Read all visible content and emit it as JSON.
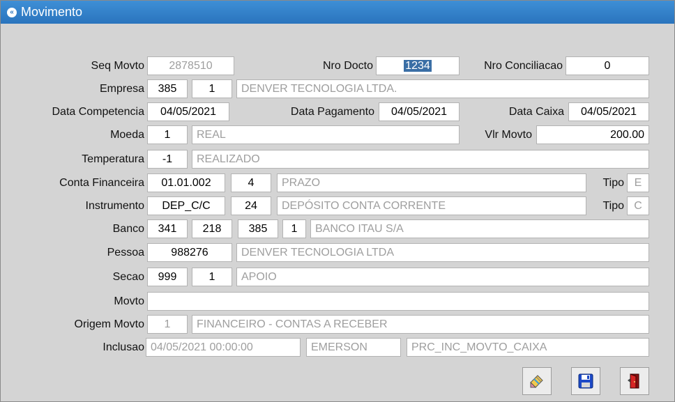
{
  "window": {
    "title": "Movimento"
  },
  "fields": {
    "seq_movto": {
      "label": "Seq Movto",
      "value": "2878510"
    },
    "nro_docto": {
      "label": "Nro Docto",
      "value": "1234"
    },
    "nro_conciliacao": {
      "label": "Nro Conciliacao",
      "value": "0"
    },
    "empresa": {
      "label": "Empresa",
      "code": "385",
      "sub": "1",
      "desc": "DENVER TECNOLOGIA LTDA."
    },
    "data_competencia": {
      "label": "Data Competencia",
      "value": "04/05/2021"
    },
    "data_pagamento": {
      "label": "Data Pagamento",
      "value": "04/05/2021"
    },
    "data_caixa": {
      "label": "Data Caixa",
      "value": "04/05/2021"
    },
    "moeda": {
      "label": "Moeda",
      "code": "1",
      "desc": "REAL"
    },
    "vlr_movto": {
      "label": "Vlr Movto",
      "value": "200.00"
    },
    "temperatura": {
      "label": "Temperatura",
      "code": "-1",
      "desc": "REALIZADO"
    },
    "conta_financeira": {
      "label": "Conta Financeira",
      "code": "01.01.002",
      "sub": "4",
      "desc": "PRAZO",
      "tipo_label": "Tipo",
      "tipo": "E"
    },
    "instrumento": {
      "label": "Instrumento",
      "code": "DEP_C/C",
      "sub": "24",
      "desc": "DEPÓSITO CONTA CORRENTE",
      "tipo_label": "Tipo",
      "tipo": "C"
    },
    "banco": {
      "label": "Banco",
      "code": "341",
      "agencia": "218",
      "conta": "385",
      "sub": "1",
      "desc": "BANCO ITAU S/A"
    },
    "pessoa": {
      "label": "Pessoa",
      "code": "988276",
      "desc": "DENVER TECNOLOGIA LTDA"
    },
    "secao": {
      "label": "Secao",
      "code": "999",
      "sub": "1",
      "desc": "APOIO"
    },
    "movto": {
      "label": "Movto",
      "value": ""
    },
    "origem_movto": {
      "label": "Origem Movto",
      "code": "1",
      "desc": "FINANCEIRO - CONTAS A RECEBER"
    },
    "inclusao": {
      "label": "Inclusao",
      "datetime": "04/05/2021 00:00:00",
      "user": "EMERSON",
      "proc": "PRC_INC_MOVTO_CAIXA"
    }
  },
  "toolbar": {
    "edit_icon": "pencil-eraser-icon",
    "save_icon": "floppy-disk-icon",
    "exit_icon": "exit-door-icon"
  },
  "colors": {
    "titlebar": "#2a74bd",
    "selection": "#3a6ea5",
    "readonly_text": "#9e9e9e"
  }
}
